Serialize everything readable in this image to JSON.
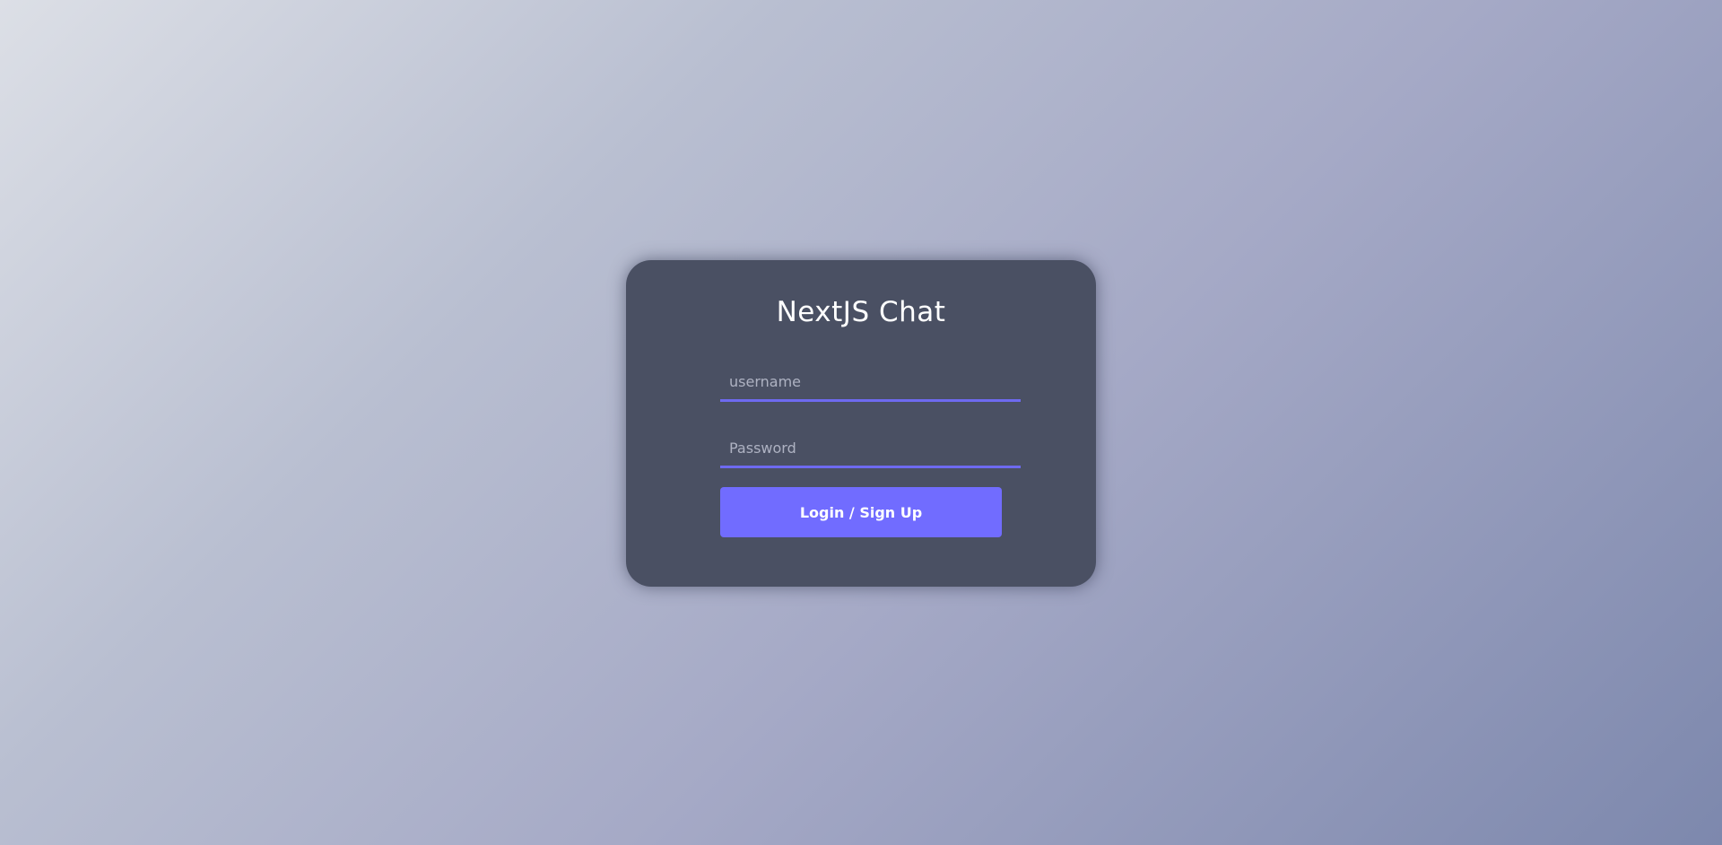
{
  "login": {
    "title": "NextJS Chat",
    "username_placeholder": "username",
    "password_placeholder": "Password",
    "submit_label": "Login / Sign Up"
  },
  "colors": {
    "card_background": "#4a5063",
    "accent": "#716cff",
    "input_underline": "#6e6af0"
  }
}
